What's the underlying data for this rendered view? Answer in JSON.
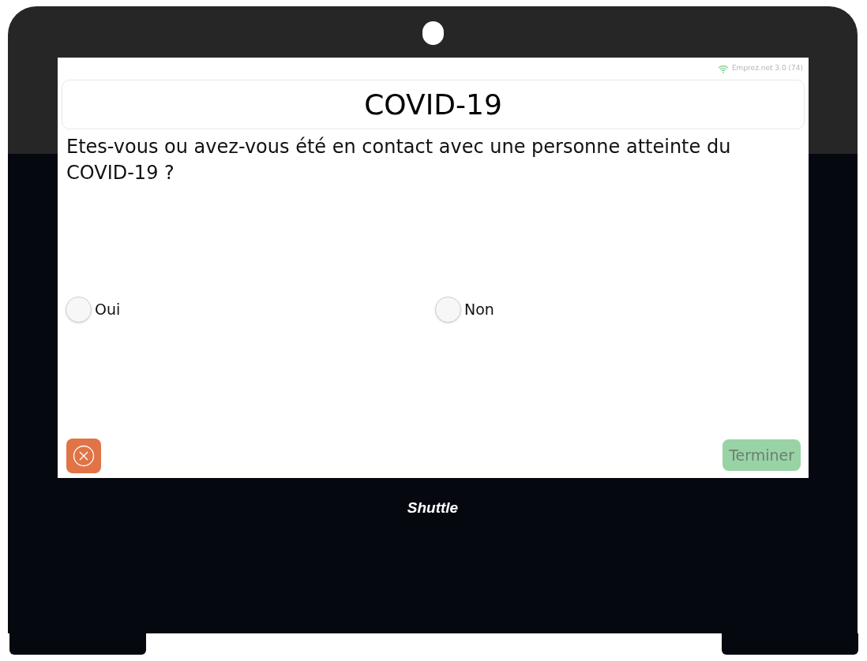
{
  "status_bar": {
    "text": "Emprez.net 3.0 (74)"
  },
  "title": "COVID-19",
  "question": "Etes-vous ou avez-vous été en contact avec une personne atteinte du COVID-19 ?",
  "options": [
    {
      "label": "Oui",
      "selected": false
    },
    {
      "label": "Non",
      "selected": false
    }
  ],
  "finish_button": {
    "label": "Terminer",
    "disabled": true
  },
  "device_label": "Shuttle"
}
